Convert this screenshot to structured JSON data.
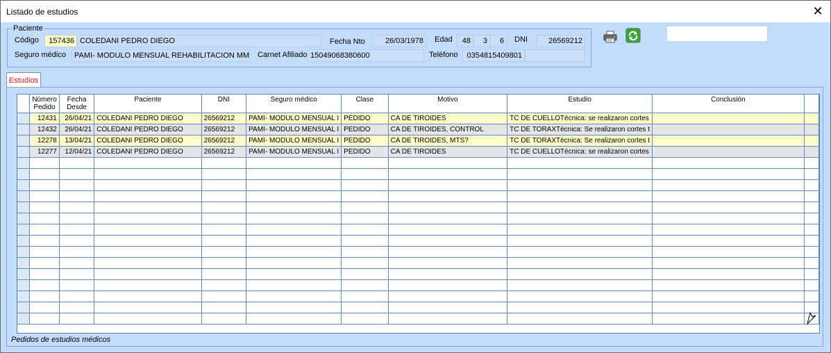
{
  "window": {
    "title": "Listado de estudios",
    "close_symbol": "✕"
  },
  "patient": {
    "group_label": "Paciente",
    "codigo_label": "Código",
    "codigo": "157436",
    "nombre": "COLEDANI PEDRO DIEGO",
    "fecha_nto_label": "Fecha Nto",
    "fecha_nto": "26/03/1978",
    "edad_label": "Edad",
    "edad_years": "48",
    "edad_months": "3",
    "edad_days": "6",
    "dni_label": "DNI",
    "dni": "26569212",
    "seguro_label": "Seguro médico",
    "seguro": "PAMI- MODULO MENSUAL REHABILITACION MMR",
    "carnet_label": "Carnet Afiliado",
    "carnet": "15049068380600",
    "telefono_label": "Teléfono",
    "telefono": "0354815409801",
    "telefono2": ""
  },
  "toolbar": {
    "print_icon": "printer-icon",
    "refresh_icon": "refresh-icon",
    "search_value": ""
  },
  "tabs": [
    {
      "label": "Estudios",
      "active": true
    }
  ],
  "grid": {
    "columns": [
      {
        "key": "numero",
        "label_l1": "Número",
        "label_l2": "Pedido"
      },
      {
        "key": "fecha",
        "label_l1": "Fecha",
        "label_l2": "Desde"
      },
      {
        "key": "paciente",
        "label_l1": "Paciente",
        "label_l2": ""
      },
      {
        "key": "dni",
        "label_l1": "DNI",
        "label_l2": ""
      },
      {
        "key": "seguro",
        "label_l1": "Seguro médico",
        "label_l2": ""
      },
      {
        "key": "clase",
        "label_l1": "Clase",
        "label_l2": ""
      },
      {
        "key": "motivo",
        "label_l1": "Motivo",
        "label_l2": ""
      },
      {
        "key": "estudio",
        "label_l1": "Estudio",
        "label_l2": ""
      },
      {
        "key": "conclusion",
        "label_l1": "Conclusión",
        "label_l2": ""
      }
    ],
    "rows": [
      {
        "numero": "12431",
        "fecha": "26/04/21",
        "paciente": "COLEDANI PEDRO DIEGO",
        "dni": "26569212",
        "seguro": "PAMI- MODULO MENSUAL I",
        "clase": "PEDIDO",
        "motivo": "CA DE TIROIDES",
        "estudio": "TC DE CUELLOTécnica: se realizaron cortes",
        "conclusion": "",
        "style": "yellow"
      },
      {
        "numero": "12432",
        "fecha": "26/04/21",
        "paciente": "COLEDANI PEDRO DIEGO",
        "dni": "26569212",
        "seguro": "PAMI- MODULO MENSUAL I",
        "clase": "PEDIDO",
        "motivo": "CA DE TIROIDES, CONTROL",
        "estudio": "TC DE TORAXTécnica: Se realizaron cortes t",
        "conclusion": "",
        "style": "gray"
      },
      {
        "numero": "12278",
        "fecha": "13/04/21",
        "paciente": "COLEDANI PEDRO DIEGO",
        "dni": "26569212",
        "seguro": "PAMI- MODULO MENSUAL I",
        "clase": "PEDIDO",
        "motivo": "CA DE TIROIDES, MTS?",
        "estudio": "TC DE TORAXTécnica: Se realizaron cortes t",
        "conclusion": "",
        "style": "yellow"
      },
      {
        "numero": "12277",
        "fecha": "12/04/21",
        "paciente": "COLEDANI PEDRO DIEGO",
        "dni": "26569212",
        "seguro": "PAMI- MODULO MENSUAL I",
        "clase": "PEDIDO",
        "motivo": "CA DE TIROIDES",
        "estudio": "TC DE CUELLOTécnica: se realizaron cortes",
        "conclusion": "",
        "style": "gray"
      }
    ]
  },
  "status": {
    "text": "Pedidos de estudios médicos"
  },
  "colors": {
    "background": "#c3dcfb",
    "row_yellow": "#fffcc8",
    "row_gray": "#e5e5e5",
    "grid_line": "#5b8cc8",
    "tab_text": "#e0161b"
  }
}
